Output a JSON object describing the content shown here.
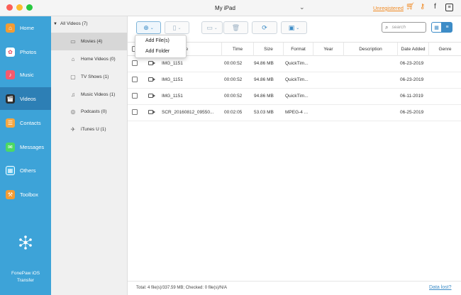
{
  "titlebar": {
    "device_name": "My iPad",
    "unregistered_label": "Unregistered"
  },
  "sidebar": {
    "items": [
      {
        "label": "Home",
        "icon": "home-icon"
      },
      {
        "label": "Photos",
        "icon": "photos-icon"
      },
      {
        "label": "Music",
        "icon": "music-icon"
      },
      {
        "label": "Videos",
        "icon": "videos-icon"
      },
      {
        "label": "Contacts",
        "icon": "contacts-icon"
      },
      {
        "label": "Messages",
        "icon": "messages-icon"
      },
      {
        "label": "Others",
        "icon": "others-icon"
      },
      {
        "label": "Toolbox",
        "icon": "toolbox-icon"
      }
    ],
    "active": "Videos",
    "brand_line1": "FonePaw iOS",
    "brand_line2": "Transfer"
  },
  "categories": {
    "header": "All Videos (7)",
    "items": [
      {
        "label": "Movies (4)",
        "icon": "movie-icon"
      },
      {
        "label": "Home Videos (0)",
        "icon": "home-video-icon"
      },
      {
        "label": "TV Shows (1)",
        "icon": "tv-icon"
      },
      {
        "label": "Music Videos (1)",
        "icon": "music-video-icon"
      },
      {
        "label": "Podcasts (0)",
        "icon": "podcast-icon"
      },
      {
        "label": "iTunes U (1)",
        "icon": "itunes-u-icon"
      }
    ],
    "active": "Movies (4)"
  },
  "toolbar": {
    "search_placeholder": "search"
  },
  "dropdown": {
    "items": [
      "Add File(s)",
      "Add Folder"
    ]
  },
  "table": {
    "columns": [
      "Name",
      "Time",
      "Size",
      "Format",
      "Year",
      "Description",
      "Date Added",
      "Genre"
    ],
    "rows": [
      {
        "name": "IMG_1151",
        "time": "00:00:52",
        "size": "94.86 MB",
        "format": "QuickTim...",
        "year": "",
        "description": "",
        "date_added": "06-23-2019",
        "genre": ""
      },
      {
        "name": "IMG_1151",
        "time": "00:00:52",
        "size": "94.86 MB",
        "format": "QuickTim...",
        "year": "",
        "description": "",
        "date_added": "06-23-2019",
        "genre": ""
      },
      {
        "name": "IMG_1151",
        "time": "00:00:52",
        "size": "94.86 MB",
        "format": "QuickTim...",
        "year": "",
        "description": "",
        "date_added": "06-11-2019",
        "genre": ""
      },
      {
        "name": "SCR_20160812_09550...",
        "time": "00:02:05",
        "size": "53.03 MB",
        "format": "MPEG-4 ...",
        "year": "",
        "description": "",
        "date_added": "06-25-2019",
        "genre": ""
      }
    ]
  },
  "status": {
    "summary": "Total: 4 file(s)/337.59 MB; Checked: 0 file(s)/N/A",
    "data_lost": "Data lost?"
  },
  "colors": {
    "sidebar": "#3da3d8",
    "sidebar_active": "#2d7fb5",
    "accent": "#3d8cc7",
    "warning": "#f08a24"
  }
}
